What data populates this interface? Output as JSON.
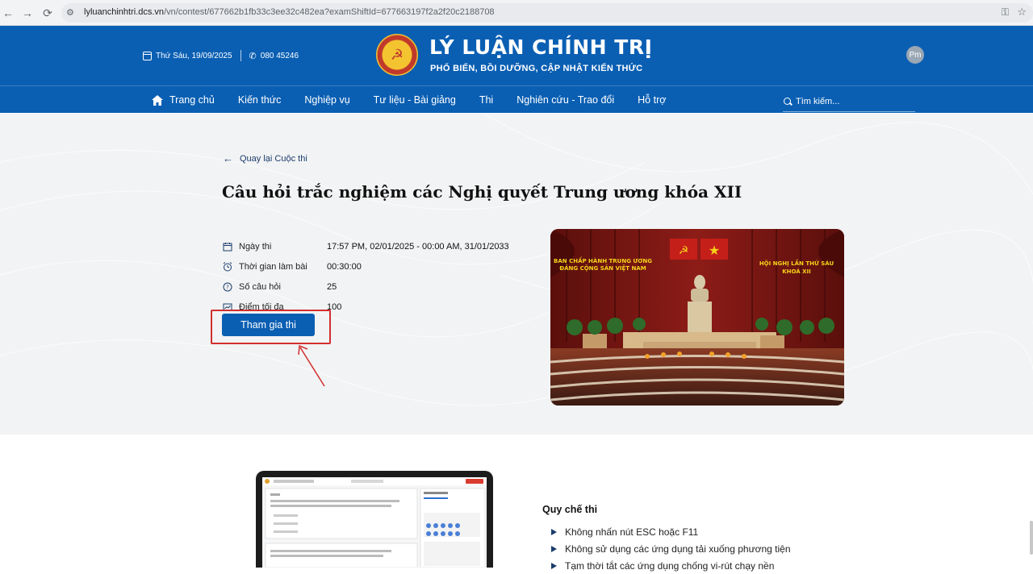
{
  "browser": {
    "url_host": "lyluanchinhtri.dcs.vn",
    "url_path": "/vn/contest/677662b1fb33c3ee32c482ea?examShiftId=677663197f2a2f20c2188708"
  },
  "header": {
    "date": "Thứ Sáu, 19/09/2025",
    "phone": "080 45246",
    "site_title": "LÝ LUẬN CHÍNH TRỊ",
    "site_subtitle": "PHỔ BIẾN, BỒI DƯỠNG, CẬP NHẬT KIẾN THỨC",
    "avatar_initials": "Pm",
    "brand_color": "#0a5fb3"
  },
  "nav": {
    "items": [
      {
        "label": "Trang chủ",
        "icon": "home-icon"
      },
      {
        "label": "Kiến thức"
      },
      {
        "label": "Nghiệp vụ"
      },
      {
        "label": "Tư liệu - Bài giảng"
      },
      {
        "label": "Thi"
      },
      {
        "label": "Nghiên cứu - Trao đổi"
      },
      {
        "label": "Hỗ trợ"
      }
    ],
    "search_placeholder": "Tìm kiếm..."
  },
  "contest": {
    "back_label": "Quay lại Cuộc thi",
    "title": "Câu hỏi trắc nghiệm các Nghị quyết Trung ương khóa XII",
    "info": [
      {
        "icon": "calendar-icon",
        "label": "Ngày thi",
        "value": "17:57 PM, 02/01/2025 - 00:00 AM, 31/01/2033"
      },
      {
        "icon": "alarm-clock-icon",
        "label": "Thời gian làm bài",
        "value": "00:30:00"
      },
      {
        "icon": "question-circle-icon",
        "label": "Số câu hỏi",
        "value": "25"
      },
      {
        "icon": "chart-icon",
        "label": "Điểm tối đa",
        "value": "100"
      }
    ],
    "join_label": "Tham gia thi",
    "image_banner_left_line1": "BAN CHẤP HÀNH TRUNG ƯƠNG",
    "image_banner_left_line2": "ĐẢNG CỘNG SẢN VIỆT NAM",
    "image_banner_right_line1": "HỘI NGHỊ LẦN THỨ SÁU",
    "image_banner_right_line2": "KHOÁ XII"
  },
  "rules": {
    "title": "Quy chế thi",
    "items": [
      "Không nhấn nút ESC hoặc F11",
      "Không sử dụng các ứng dụng tải xuống phương tiện",
      "Tạm thời tắt các ứng dụng chống vi-rút chạy nền"
    ]
  }
}
